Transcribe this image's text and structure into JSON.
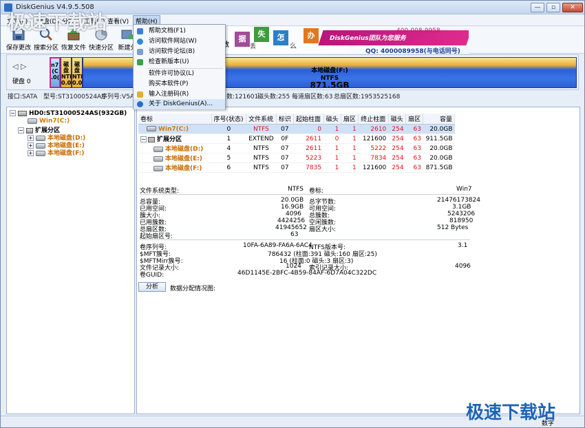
{
  "window": {
    "title": "DiskGenius V4.9.5.508"
  },
  "menubar": {
    "items": [
      "文件(F)",
      "硬盘(D)",
      "分区",
      "工具(T)",
      "查看(V)",
      "帮助(H)"
    ]
  },
  "toolbar": {
    "buttons": [
      {
        "label": "保存更改",
        "icon": "save-icon"
      },
      {
        "label": "搜索分区",
        "icon": "search-icon"
      },
      {
        "label": "恢复文件",
        "icon": "recover-icon"
      },
      {
        "label": "快速分区",
        "icon": "quick-partition-icon"
      },
      {
        "label": "新建分",
        "icon": "new-partition-icon"
      }
    ]
  },
  "banner": {
    "tiles": [
      "据",
      "失",
      "怎",
      "办"
    ],
    "small": [
      "数",
      "丢",
      "么"
    ],
    "team": "DiskGenius团队为您服务",
    "phone": "400-008-9958",
    "qq": "QQ: 4000089958(与电话同号)"
  },
  "help_menu": {
    "items": [
      "帮助文档(F1)",
      "访问软件网站(W)",
      "访问软件论坛(B)",
      "检查新版本(U)",
      "软件许可协议(L)",
      "购买本软件(P)",
      "输入注册码(R)",
      "关于 DiskGenius(A)..."
    ]
  },
  "diskbar": {
    "disk_label": "硬盘 0",
    "big_partition": {
      "name": "本地磁盘(F:)",
      "fs": "NTFS",
      "size": "871.5GB"
    },
    "small_parts": [
      {
        "l1": "n7(",
        "l2": "(C",
        "l3": ".0("
      },
      {
        "l1": "磁盘",
        "l2": "NTFS",
        "l3": "0.0("
      },
      {
        "l1": "磁盘",
        "l2": "NTFS",
        "l3": "0.0("
      },
      {
        "l1": "",
        "l2": "",
        "l3": ""
      }
    ]
  },
  "infoline": {
    "iface": "接口:SATA",
    "model": "型号:ST31000524AS",
    "serial": "序列号:V5APB",
    "cyl": "数:121601",
    "heads": "磁头数:255",
    "spt": "每道扇区数:63",
    "total": "总扇区数:1953525168"
  },
  "tree": {
    "disk": "HD0:ST31000524AS(932GB)",
    "win7": "Win7(C:)",
    "ext": "扩展分区",
    "parts": [
      "本地磁盘(D:)",
      "本地磁盘(E:)",
      "本地磁盘(F:)"
    ]
  },
  "table": {
    "headers": [
      "卷标",
      "序号(状态)",
      "文件系统",
      "标识",
      "起始柱面",
      "磁头",
      "扇区",
      "终止柱面",
      "磁头",
      "扇区",
      "容量"
    ],
    "rows": [
      {
        "name": "Win7(C:)",
        "idx": "0",
        "fs": "NTFS",
        "id": "07",
        "sc": "0",
        "sh": "1",
        "ss": "1",
        "ec": "2610",
        "eh": "254",
        "es": "63",
        "cap": "20.0GB",
        "sel": true
      },
      {
        "name": "扩展分区",
        "idx": "1",
        "fs": "EXTEND",
        "id": "0F",
        "sc": "2611",
        "sh": "0",
        "ss": "1",
        "ec": "121600",
        "eh": "254",
        "es": "63",
        "cap": "911.5GB",
        "sel": false
      },
      {
        "name": "本地磁盘(D:)",
        "idx": "4",
        "fs": "NTFS",
        "id": "07",
        "sc": "2611",
        "sh": "1",
        "ss": "1",
        "ec": "5222",
        "eh": "254",
        "es": "63",
        "cap": "20.0GB",
        "sel": false
      },
      {
        "name": "本地磁盘(E:)",
        "idx": "5",
        "fs": "NTFS",
        "id": "07",
        "sc": "5223",
        "sh": "1",
        "ss": "1",
        "ec": "7834",
        "eh": "254",
        "es": "63",
        "cap": "20.0GB",
        "sel": false
      },
      {
        "name": "本地磁盘(F:)",
        "idx": "6",
        "fs": "NTFS",
        "id": "07",
        "sc": "7835",
        "sh": "1",
        "ss": "1",
        "ec": "121600",
        "eh": "254",
        "es": "63",
        "cap": "871.5GB",
        "sel": false
      }
    ]
  },
  "details": {
    "fs_type_label": "文件系统类型:",
    "fs_type": "NTFS",
    "vol_label_label": "卷标:",
    "vol_label": "Win7",
    "total_cap_label": "总容量:",
    "total_cap": "20.0GB",
    "total_bytes_label": "总字节数:",
    "total_bytes": "21476173824",
    "used_label": "已用空间:",
    "used": "16.9GB",
    "free_label": "可用空间:",
    "free": "3.1GB",
    "cluster_label": "簇大小:",
    "cluster": "4096",
    "total_clusters_label": "总簇数:",
    "total_clusters": "5243206",
    "used_clusters_label": "已用簇数:",
    "used_clusters": "4424256",
    "free_clusters_label": "空闲簇数:",
    "free_clusters": "818950",
    "total_sectors_label": "总扇区数:",
    "total_sectors": "41945652",
    "sector_size_label": "扇区大小:",
    "sector_size": "512 Bytes",
    "start_sector_label": "起始扇区号:",
    "start_sector": "63",
    "serial_label": "卷序列号:",
    "serial": "10FA-6A89-FA6A-6AC4",
    "ntfs_ver_label": "NTFS版本号:",
    "ntfs_ver": "3.1",
    "mft_label": "$MFT簇号:",
    "mft": "786432 (柱面:391 磁头:160 扇区:25)",
    "mftmirr_label": "$MFTMirr簇号:",
    "mftmirr": "16 (柱面:0 磁头:3 扇区:3)",
    "record_label": "文件记录大小:",
    "record": "1024",
    "index_label": "索引记录大小:",
    "index": "4096",
    "guid_label": "卷GUID:",
    "guid": "46D1145E-2BFC-4B59-84AF-6D7A04C322DC"
  },
  "actions": {
    "analyze": "分析",
    "dist": "数据分配情况图:"
  },
  "status": {
    "numlock": "数字"
  },
  "watermark": {
    "top": "极速下载站",
    "bottom": "极速下载站"
  }
}
